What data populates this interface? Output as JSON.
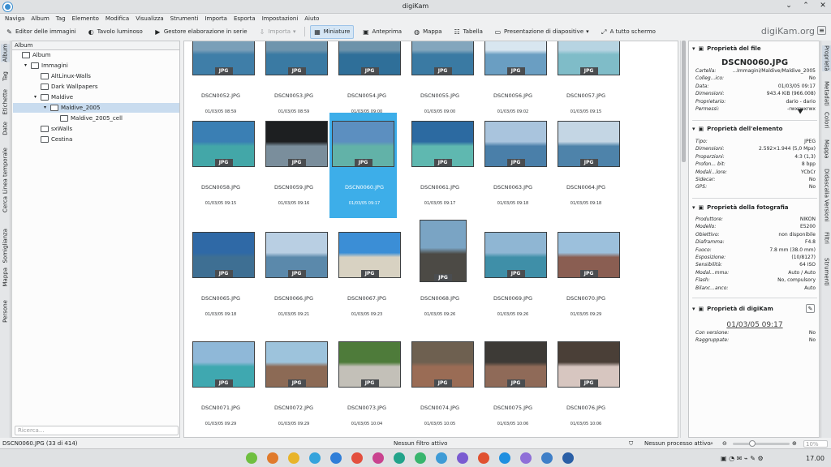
{
  "window": {
    "title": "digiKam"
  },
  "menu": [
    "Naviga",
    "Album",
    "Tag",
    "Elemento",
    "Modifica",
    "Visualizza",
    "Strumenti",
    "Importa",
    "Esporta",
    "Impostazioni",
    "Aiuto"
  ],
  "toolbar": {
    "editor": "Editor delle immagini",
    "lighttable": "Tavolo luminoso",
    "batch": "Gestore elaborazione in serie",
    "import": "Importa",
    "thumbs": "Miniature",
    "preview": "Anteprima",
    "map": "Mappa",
    "table": "Tabella",
    "slideshow": "Presentazione di diapositive",
    "fullscreen": "A tutto schermo",
    "brand": "digiKam.org"
  },
  "left_tabs": [
    "Album",
    "Tag",
    "Etichette",
    "Date",
    "Linea temporale",
    "Cerca",
    "Somiglianza",
    "Mappa",
    "Persone"
  ],
  "album_panel": {
    "header": "Album",
    "tree": [
      {
        "label": "Album",
        "level": 0,
        "arrow": ""
      },
      {
        "label": "Immagini",
        "level": 1,
        "arrow": "▾"
      },
      {
        "label": "AltLinux-Walls",
        "level": 2,
        "arrow": ""
      },
      {
        "label": "Dark Wallpapers",
        "level": 2,
        "arrow": ""
      },
      {
        "label": "Maldive",
        "level": 2,
        "arrow": "▾"
      },
      {
        "label": "Maldive_2005",
        "level": 3,
        "arrow": "▾"
      },
      {
        "label": "Maldive_2005_cell",
        "level": 4,
        "arrow": ""
      },
      {
        "label": "sxWalls",
        "level": 2,
        "arrow": ""
      },
      {
        "label": "Cestina",
        "level": 2,
        "arrow": ""
      }
    ],
    "search_placeholder": "Ricerca..."
  },
  "thumbnails": [
    {
      "name": "DSCN0052.JPG",
      "date": "01/03/05 08:59",
      "colors": [
        "#7a9fb8",
        "#3f7ea8"
      ]
    },
    {
      "name": "DSCN0053.JPG",
      "date": "01/03/05 08:59",
      "colors": [
        "#6f95ad",
        "#3a7aa3"
      ]
    },
    {
      "name": "DSCN0054.JPG",
      "date": "01/03/05 09:00",
      "colors": [
        "#6d93aa",
        "#2f6f99"
      ]
    },
    {
      "name": "DSCN0055.JPG",
      "date": "01/03/05 09:00",
      "colors": [
        "#83a6bd",
        "#3a7aa3"
      ]
    },
    {
      "name": "DSCN0056.JPG",
      "date": "01/03/05 09:02",
      "colors": [
        "#d8e6f0",
        "#6a9ec2"
      ]
    },
    {
      "name": "DSCN0057.JPG",
      "date": "01/03/05 09:15",
      "colors": [
        "#b7d4e2",
        "#7fbcc8"
      ]
    },
    {
      "name": "DSCN0058.JPG",
      "date": "01/03/05 09:15",
      "colors": [
        "#3a7fb4",
        "#43a7a8"
      ]
    },
    {
      "name": "DSCN0059.JPG",
      "date": "01/03/05 09:16",
      "colors": [
        "#1d1f21",
        "#7a8e9c"
      ]
    },
    {
      "name": "DSCN0060.JPG",
      "date": "01/03/05 09:17",
      "colors": [
        "#5c8fc0",
        "#62b2a8"
      ]
    },
    {
      "name": "DSCN0061.JPG",
      "date": "01/03/05 09:17",
      "colors": [
        "#2c6aa1",
        "#5fb8b0"
      ]
    },
    {
      "name": "DSCN0063.JPG",
      "date": "01/03/05 09:18",
      "colors": [
        "#a9c4dd",
        "#4a7fa9"
      ]
    },
    {
      "name": "DSCN0064.JPG",
      "date": "01/03/05 09:18",
      "colors": [
        "#c4d6e4",
        "#4e83aa"
      ]
    },
    {
      "name": "DSCN0065.JPG",
      "date": "01/03/05 09:18",
      "colors": [
        "#2f69a6",
        "#3e6f93"
      ]
    },
    {
      "name": "DSCN0066.JPG",
      "date": "01/03/05 09:21",
      "colors": [
        "#b9cfe3",
        "#5b89ab"
      ]
    },
    {
      "name": "DSCN0067.JPG",
      "date": "01/03/05 09:23",
      "colors": [
        "#3b8ed6",
        "#d8d2c2"
      ]
    },
    {
      "name": "DSCN0068.JPG",
      "date": "01/03/05 09:26",
      "colors": [
        "#7aa4c4",
        "#4c4a45"
      ]
    },
    {
      "name": "DSCN0069.JPG",
      "date": "01/03/05 09:26",
      "colors": [
        "#8fb6d3",
        "#3f8fa8"
      ]
    },
    {
      "name": "DSCN0070.JPG",
      "date": "01/03/05 09:29",
      "colors": [
        "#9cc0dc",
        "#8a5e52"
      ]
    },
    {
      "name": "DSCN0071.JPG",
      "date": "01/03/05 09:29",
      "colors": [
        "#8fb8d8",
        "#3fa8b0"
      ]
    },
    {
      "name": "DSCN0072.JPG",
      "date": "01/03/05 09:29",
      "colors": [
        "#9dc3dc",
        "#8c6a55"
      ]
    },
    {
      "name": "DSCN0073.JPG",
      "date": "01/03/05 10:04",
      "colors": [
        "#4e7b3a",
        "#c3c0b8"
      ]
    },
    {
      "name": "DSCN0074.JPG",
      "date": "01/03/05 10:05",
      "colors": [
        "#6e6050",
        "#9a6c55"
      ]
    },
    {
      "name": "DSCN0075.JPG",
      "date": "01/03/05 10:06",
      "colors": [
        "#3d3a36",
        "#8f6a58"
      ]
    },
    {
      "name": "DSCN0076.JPG",
      "date": "01/03/05 10:06",
      "colors": [
        "#4a3f37",
        "#d7c6c0"
      ]
    }
  ],
  "selected_index": 8,
  "right_panel": {
    "file_header": "Proprietà del file",
    "file_name": "DSCN0060.JPG",
    "file_props": [
      {
        "k": "Cartella:",
        "v": "...Immagini/Maldive/Maldive_2005"
      },
      {
        "k": "Colleg...ico:",
        "v": "No"
      },
      {
        "k": "Data:",
        "v": "01/03/05 09:17"
      },
      {
        "k": "Dimensioni:",
        "v": "943.4 KiB (966.008)"
      },
      {
        "k": "Proprietario:",
        "v": "dario - dario"
      },
      {
        "k": "Permessi:",
        "v": "-rwxrwxrwx"
      }
    ],
    "item_header": "Proprietà dell'elemento",
    "item_props": [
      {
        "k": "Tipo:",
        "v": "JPEG"
      },
      {
        "k": "Dimensioni:",
        "v": "2.592×1.944 (5,0 Mpx)"
      },
      {
        "k": "Proporzioni:",
        "v": "4:3 (1,3)"
      },
      {
        "k": "Profon... bit:",
        "v": "8 bpp"
      },
      {
        "k": "Modali...lore:",
        "v": "YCbCr"
      },
      {
        "k": "Sidecar:",
        "v": "No"
      },
      {
        "k": "GPS:",
        "v": "No"
      }
    ],
    "photo_header": "Proprietà della fotografia",
    "photo_props": [
      {
        "k": "Produttore:",
        "v": "NIKON"
      },
      {
        "k": "Modello:",
        "v": "E5200"
      },
      {
        "k": "Obiettivo:",
        "v": "non disponibile"
      },
      {
        "k": "Diaframma:",
        "v": "F4.8"
      },
      {
        "k": "Fuoco:",
        "v": "7.8 mm (38.0 mm)"
      },
      {
        "k": "Esposizione:",
        "v": "(10/8127)"
      },
      {
        "k": "Sensibilità:",
        "v": "64 ISO"
      },
      {
        "k": "Modal...mma:",
        "v": "Auto / Auto"
      },
      {
        "k": "Flash:",
        "v": "No, compulsory"
      },
      {
        "k": "Bilanc...anco:",
        "v": "Auto"
      }
    ],
    "digikam_header": "Proprietà di digiKam",
    "digikam_date": "01/03/05 09:17",
    "digikam_props": [
      {
        "k": "Con versione:",
        "v": "No"
      },
      {
        "k": "Raggruppate:",
        "v": "No"
      }
    ]
  },
  "right_tabs": [
    "Proprietà",
    "Metadati",
    "Colori",
    "Mappa",
    "Didascalia",
    "Versioni",
    "Filtri",
    "Strumenti"
  ],
  "status": {
    "left": "DSCN0060.JPG (33 di 414)",
    "filter": "Nessun filtro attivo",
    "process": "Nessun processo attivo",
    "zoom": "10%"
  },
  "taskbar": {
    "time": "17.00",
    "icon_colors": [
      "#6fbf40",
      "#e07a2c",
      "#e8b42a",
      "#35a3dc",
      "#2f7ed8",
      "#e34f3e",
      "#c9438f",
      "#22a38a",
      "#38b56d",
      "#3e9bd6",
      "#7a5bd1",
      "#e05130",
      "#1f8fe0",
      "#8f6fd8",
      "#3f7fc8",
      "#2a5fa6"
    ]
  }
}
